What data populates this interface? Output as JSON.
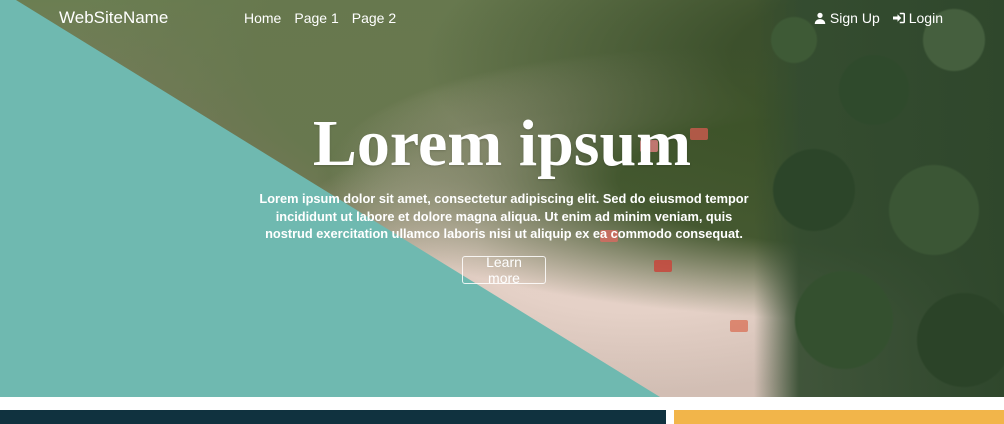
{
  "navbar": {
    "brand": "WebSiteName",
    "links": [
      {
        "label": "Home"
      },
      {
        "label": "Page 1"
      },
      {
        "label": "Page 2"
      }
    ],
    "auth": [
      {
        "label": "Sign Up",
        "icon": "user-icon"
      },
      {
        "label": "Login",
        "icon": "login-icon"
      }
    ]
  },
  "hero": {
    "title": "Lorem ipsum",
    "text": "Lorem ipsum dolor sit amet, consectetur adipiscing elit. Sed do eiusmod tempor incididunt ut labore et dolore magna aliqua. Ut enim ad minim veniam, quis nostrud exercitation ullamco laboris nisi ut aliquip ex ea commodo consequat.",
    "button_label": "Learn more"
  },
  "colors": {
    "teal": "#6fb9b0",
    "dark_bar": "#10323f",
    "gold_bar": "#f2b54a"
  }
}
